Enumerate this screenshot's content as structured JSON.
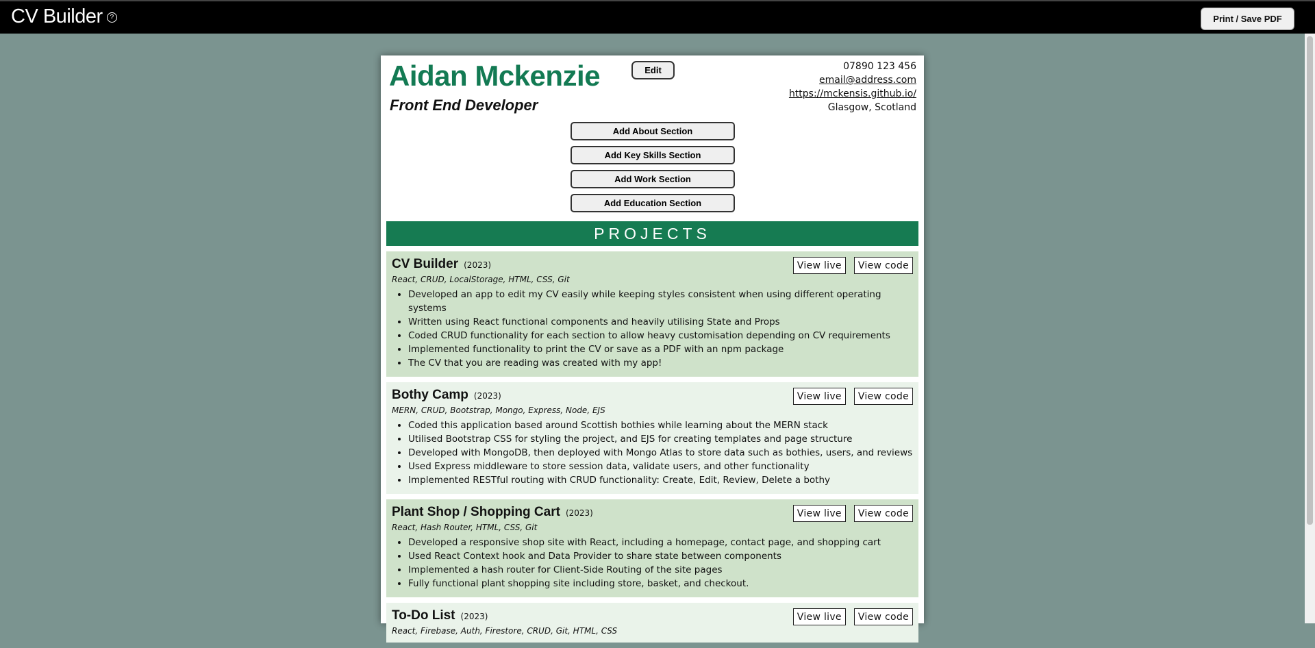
{
  "header": {
    "app_title": "CV Builder",
    "help_icon": "?",
    "print_label": "Print / Save PDF"
  },
  "cv": {
    "name": "Aidan Mckenzie",
    "role": "Front End Developer",
    "edit_label": "Edit",
    "contact": {
      "phone": "07890 123 456",
      "email": "email@address.com",
      "website": "https://mckensis.github.io/",
      "location": "Glasgow, Scotland"
    },
    "add_buttons": [
      "Add About Section",
      "Add Key Skills Section",
      "Add Work Section",
      "Add Education Section"
    ],
    "projects_heading": "PROJECTS",
    "view_live_label": "View live",
    "view_code_label": "View code",
    "projects": [
      {
        "title": "CV Builder",
        "year": "(2023)",
        "tech": "React, CRUD, LocalStorage, HTML, CSS, Git",
        "points": [
          "Developed an app to edit my CV easily while keeping styles consistent when using different operating systems",
          "Written using React functional components and heavily utilising State and Props",
          "Coded CRUD functionality for each section to allow heavy customisation depending on CV requirements",
          "Implemented functionality to print the CV or save as a PDF with an npm package",
          "The CV that you are reading was created with my app!"
        ]
      },
      {
        "title": "Bothy Camp",
        "year": "(2023)",
        "tech": "MERN, CRUD, Bootstrap, Mongo, Express, Node, EJS",
        "points": [
          "Coded this application based around Scottish bothies while learning about the MERN stack",
          "Utilised Bootstrap CSS for styling the project, and EJS for creating templates and page structure",
          "Developed with MongoDB, then deployed with Mongo Atlas to store data such as bothies, users, and reviews",
          "Used Express middleware to store session data, validate users, and other functionality",
          "Implemented RESTful routing with CRUD functionality: Create, Edit, Review, Delete a bothy"
        ]
      },
      {
        "title": "Plant Shop / Shopping Cart",
        "year": "(2023)",
        "tech": "React, Hash Router, HTML, CSS, Git",
        "points": [
          "Developed a responsive shop site with React, including a homepage, contact page, and shopping cart",
          "Used React Context hook and Data Provider to share state between components",
          "Implemented a hash router for Client-Side Routing of the site pages",
          "Fully functional plant shopping site including store, basket, and checkout."
        ]
      },
      {
        "title": "To-Do List",
        "year": "(2023)",
        "tech": "React, Firebase, Auth, Firestore, CRUD, Git, HTML, CSS",
        "points": []
      }
    ]
  }
}
